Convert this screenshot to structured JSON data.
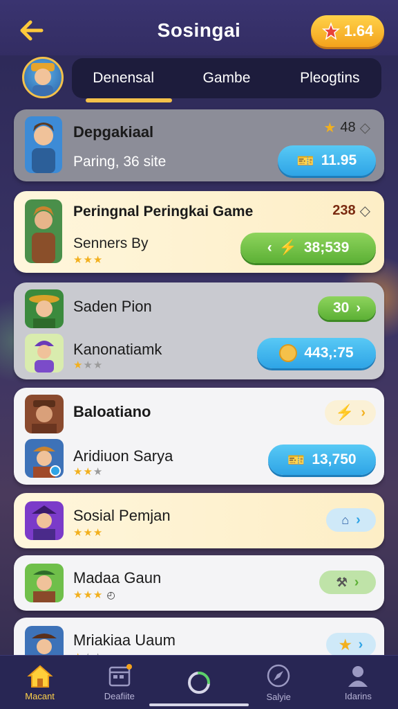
{
  "header": {
    "title": "Sosingai",
    "coin_value": "1.64"
  },
  "tabs": [
    {
      "label": "Denensal",
      "active": true
    },
    {
      "label": "Gambe",
      "active": false
    },
    {
      "label": "Pleogtins",
      "active": false
    }
  ],
  "list": {
    "items": [
      {
        "name": "Depgakiaal",
        "subtitle": "Paring, 36 site",
        "score": "48",
        "action_value": "11.95"
      },
      {
        "name": "Peringnal Peringkai Game",
        "subtitle": "Senners By",
        "score": "238",
        "stars": 3,
        "action_value": "38;539"
      },
      {
        "name": "Saden Pion",
        "action_value": "30"
      },
      {
        "name": "Kanonatiamk",
        "stars": 3,
        "action_value": "443,:75"
      },
      {
        "name": "Baloatiano"
      },
      {
        "name": "Aridiuon Sarya",
        "stars": 3,
        "action_value": "13,750"
      },
      {
        "name": "Sosial Pemjan",
        "stars": 3
      },
      {
        "name": "Madaa Gaun",
        "stars": 3
      },
      {
        "name": "Mriakiaa Uaum"
      }
    ]
  },
  "nav": [
    {
      "label": "Macant",
      "icon": "home-icon",
      "active": true
    },
    {
      "label": "Deafiite",
      "icon": "calendar-icon",
      "active": false
    },
    {
      "label": "",
      "icon": "refresh-icon",
      "active": false
    },
    {
      "label": "Salyie",
      "icon": "compass-icon",
      "active": false
    },
    {
      "label": "Idarins",
      "icon": "profile-icon",
      "active": false
    }
  ],
  "colors": {
    "accent": "#ffd24a",
    "blue_button": "#2ea4e6",
    "green_button": "#5cb035",
    "tab_bar": "#1d1c3c"
  }
}
